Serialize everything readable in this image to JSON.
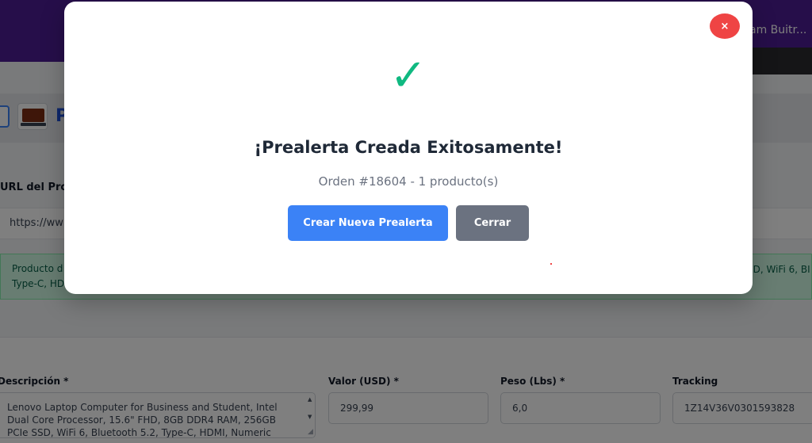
{
  "header": {
    "user_name": "am Buitr..."
  },
  "product": {
    "letter": "P"
  },
  "url_section": {
    "label": "URL del Producto",
    "value": "https://ww"
  },
  "found": {
    "line1": "Producto d",
    "line2": "Type-C, HD",
    "right": "SD, WiFi 6, BI"
  },
  "form": {
    "description_label": "Descripción *",
    "description_value": "Lenovo Laptop Computer for Business and Student, Intel Dual Core Processor, 15.6\" FHD, 8GB DDR4 RAM, 256GB PCIe SSD, WiFi 6, Bluetooth 5.2, Type-C, HDMI, Numeric",
    "value_label": "Valor (USD) *",
    "value_value": "299,99",
    "weight_label": "Peso (Lbs) *",
    "weight_value": "6,0",
    "tracking_label": "Tracking",
    "tracking_value": "1Z14V36V0301593828"
  },
  "modal": {
    "close_label": "×",
    "check_glyph": "✓",
    "title": "¡Prealerta Creada Exitosamente!",
    "subtitle": "Orden #18604 - 1 producto(s)",
    "primary_button": "Crear Nueva Prealerta",
    "secondary_button": "Cerrar"
  },
  "colors": {
    "success": "#10b981",
    "primary": "#3b82f6",
    "secondary": "#6b7280",
    "danger": "#ef4444",
    "header": "#4c1d95"
  }
}
